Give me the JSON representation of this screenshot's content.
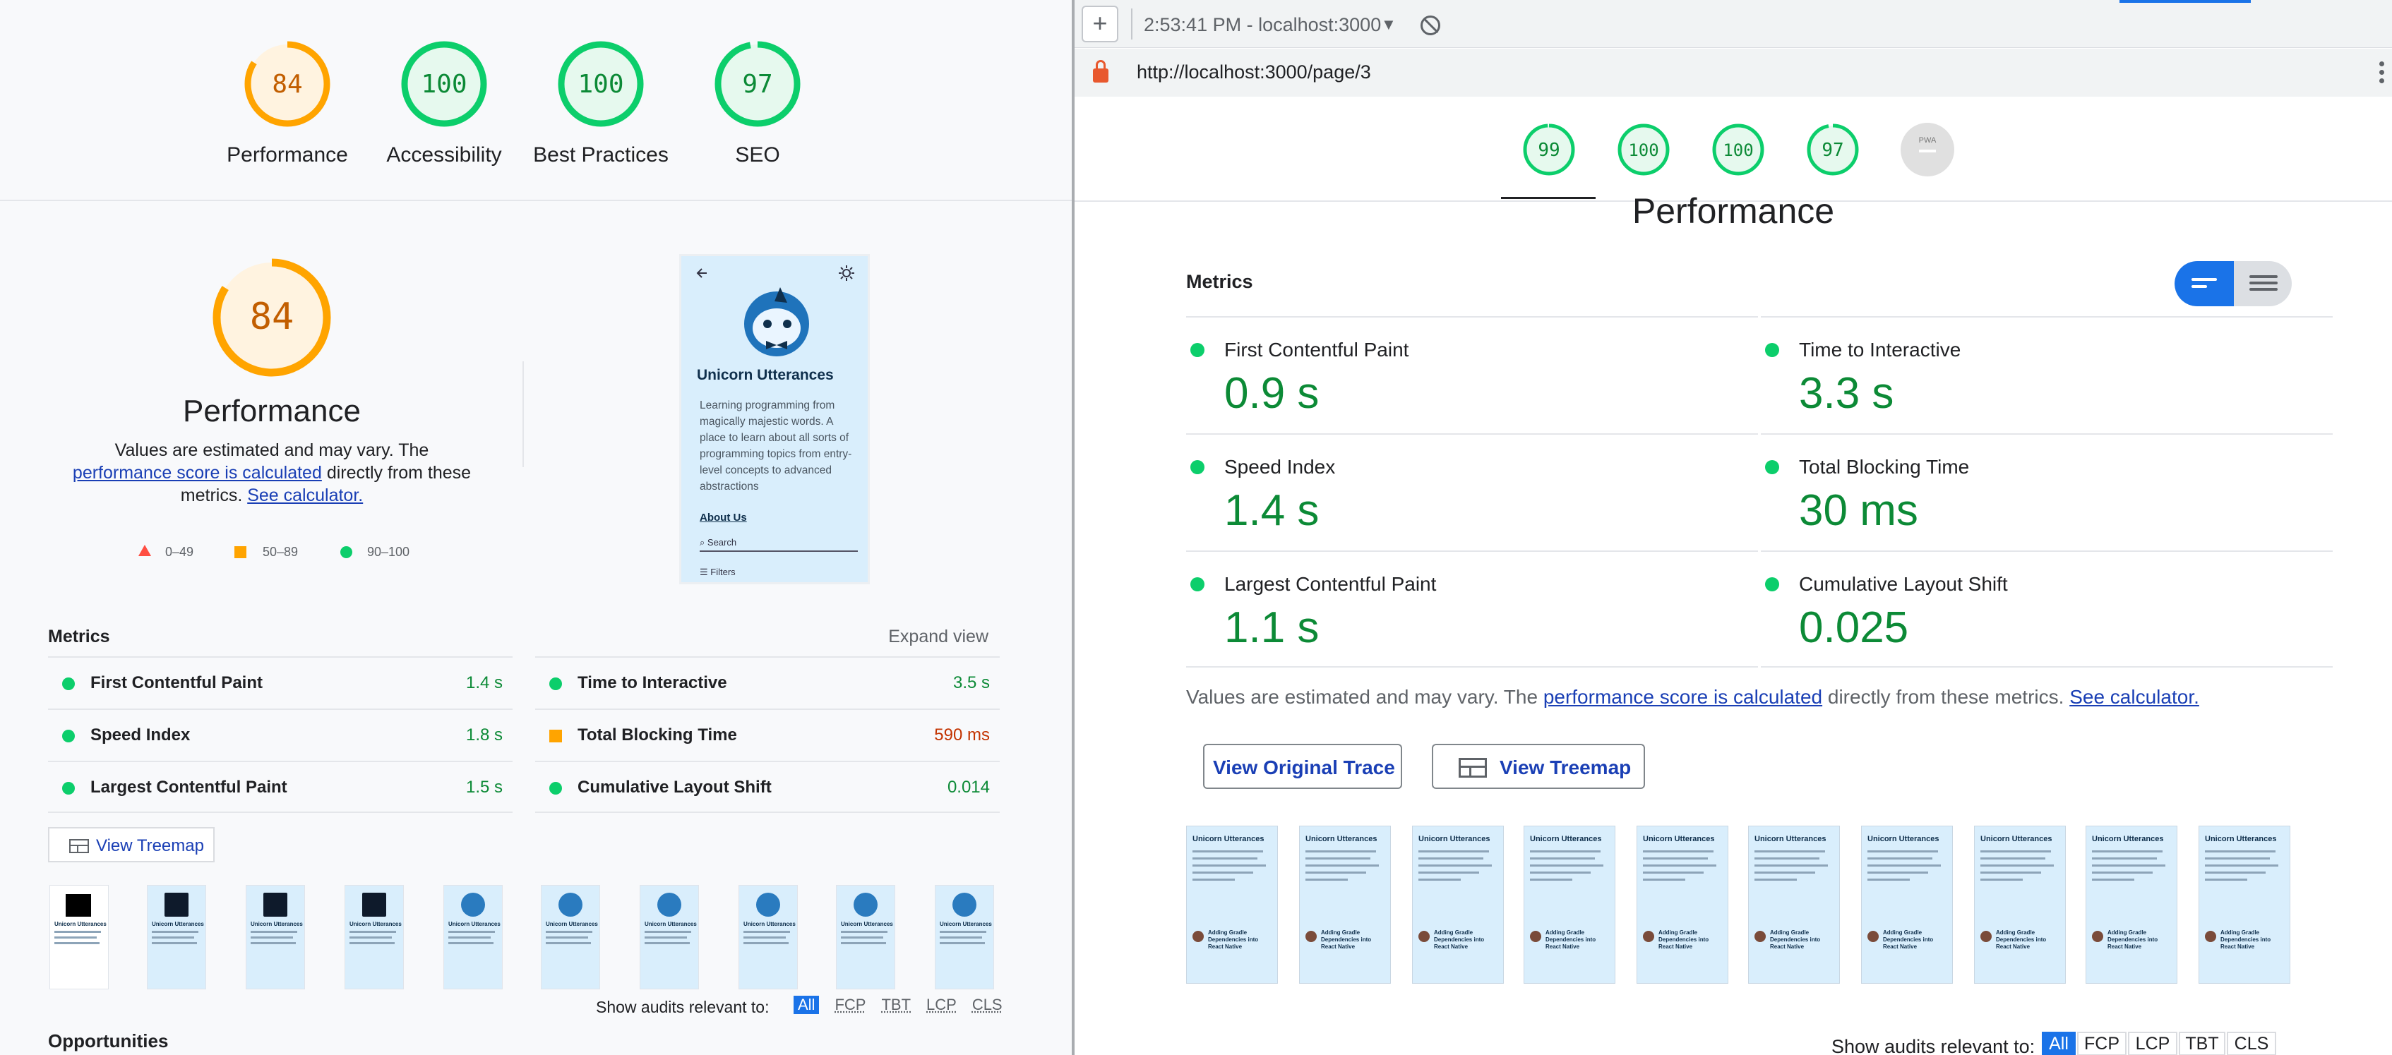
{
  "left_panel": {
    "categories": [
      {
        "score": "84",
        "label": "Performance",
        "value": 84,
        "color": "#ffa400",
        "bg": "#fff3e0"
      },
      {
        "score": "100",
        "label": "Accessibility",
        "value": 100,
        "color": "#0cce6b",
        "bg": "#e6f9ee"
      },
      {
        "score": "100",
        "label": "Best Practices",
        "value": 100,
        "color": "#0cce6b",
        "bg": "#e6f9ee"
      },
      {
        "score": "97",
        "label": "SEO",
        "value": 97,
        "color": "#0cce6b",
        "bg": "#e6f9ee"
      }
    ],
    "perf": {
      "score": "84",
      "value": 84,
      "title": "Performance",
      "desc_start": "Values are estimated and may vary. The ",
      "desc_link": "performance score is calculated",
      "desc_mid": " directly from these metrics. ",
      "desc_link2": "See calculator."
    },
    "legend": {
      "fail": "0–49",
      "average": "50–89",
      "pass": "90–100"
    },
    "screenshot": {
      "title": "Unicorn Utterances",
      "description": "Learning programming from magically majestic words. A place to learn about all sorts of programming topics from entry-level concepts to advanced abstractions",
      "about": "About Us",
      "search": "Search",
      "filters": "Filters"
    },
    "metrics_heading": "Metrics",
    "expand_view": "Expand view",
    "metrics": [
      {
        "name": "First Contentful Paint",
        "value": "1.4 s",
        "status": "pass"
      },
      {
        "name": "Time to Interactive",
        "value": "3.5 s",
        "status": "pass"
      },
      {
        "name": "Speed Index",
        "value": "1.8 s",
        "status": "pass"
      },
      {
        "name": "Total Blocking Time",
        "value": "590 ms",
        "status": "average"
      },
      {
        "name": "Largest Contentful Paint",
        "value": "1.5 s",
        "status": "pass"
      },
      {
        "name": "Cumulative Layout Shift",
        "value": "0.014",
        "status": "pass"
      }
    ],
    "treemap_button": "View Treemap",
    "thumbnail_title": "Unicorn Utterances",
    "show_audits_label": "Show audits relevant to:",
    "filter_chips": [
      "All",
      "FCP",
      "TBT",
      "LCP",
      "CLS"
    ],
    "opportunities_heading": "Opportunities"
  },
  "right_panel": {
    "timestamp": "2:53:41 PM - localhost:3000",
    "url": "http://localhost:3000/page/3",
    "gauges": [
      {
        "score": "99",
        "value": 99,
        "color": "#0cce6b",
        "bg": "#e6f9ee"
      },
      {
        "score": "100",
        "value": 100,
        "color": "#0cce6b",
        "bg": "#e6f9ee"
      },
      {
        "score": "100",
        "value": 100,
        "color": "#0cce6b",
        "bg": "#e6f9ee"
      },
      {
        "score": "97",
        "value": 97,
        "color": "#0cce6b",
        "bg": "#e6f9ee"
      }
    ],
    "pwa_label": "PWA",
    "section_title": "Performance",
    "metrics_heading": "Metrics",
    "metrics": [
      {
        "name": "First Contentful Paint",
        "value": "0.9 s"
      },
      {
        "name": "Time to Interactive",
        "value": "3.3 s"
      },
      {
        "name": "Speed Index",
        "value": "1.4 s"
      },
      {
        "name": "Total Blocking Time",
        "value": "30 ms"
      },
      {
        "name": "Largest Contentful Paint",
        "value": "1.1 s"
      },
      {
        "name": "Cumulative Layout Shift",
        "value": "0.025"
      }
    ],
    "desc_start": "Values are estimated and may vary. The ",
    "desc_link": "performance score is calculated",
    "desc_mid": " directly from these metrics. ",
    "desc_link2": "See calculator.",
    "view_trace_button": "View Original Trace",
    "view_treemap_button": "View Treemap",
    "thumbnail_title": "Unicorn Utterances",
    "thumbnail_post": "Adding Gradle Dependencies into React Native",
    "show_audits_label": "Show audits relevant to:",
    "filter_chips": [
      "All",
      "FCP",
      "LCP",
      "TBT",
      "CLS"
    ]
  },
  "colors": {
    "pass": "#0cce6b",
    "average": "#ffa400",
    "fail": "#ff4e42",
    "link": "#1a3fb5",
    "accent": "#1a73e8"
  }
}
